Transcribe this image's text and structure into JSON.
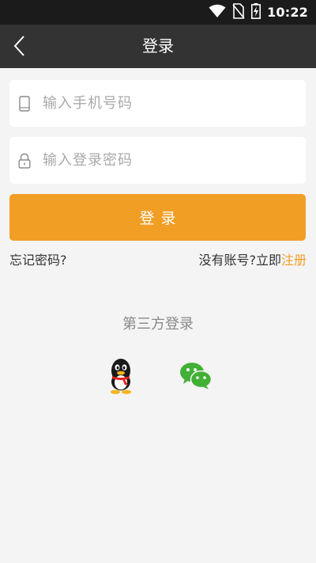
{
  "status_bar": {
    "time": "10:22",
    "icons": [
      "wifi-icon",
      "no-sim-icon",
      "battery-charging-icon"
    ]
  },
  "header": {
    "title": "登录",
    "back_icon": "back-arrow-icon"
  },
  "form": {
    "phone": {
      "icon": "phone-icon",
      "placeholder": "输入手机号码",
      "value": ""
    },
    "password": {
      "icon": "lock-icon",
      "placeholder": "输入登录密码",
      "value": ""
    },
    "login_button": "登录"
  },
  "links": {
    "forgot_password": "忘记密码?",
    "no_account": "没有账号?立即",
    "register": "注册"
  },
  "third_party": {
    "title": "第三方登录",
    "options": [
      "qq-icon",
      "wechat-icon"
    ]
  },
  "colors": {
    "accent": "#f19e25",
    "header_bg": "#333333",
    "status_bg": "#1b1b1b",
    "page_bg": "#f4f4f4"
  }
}
